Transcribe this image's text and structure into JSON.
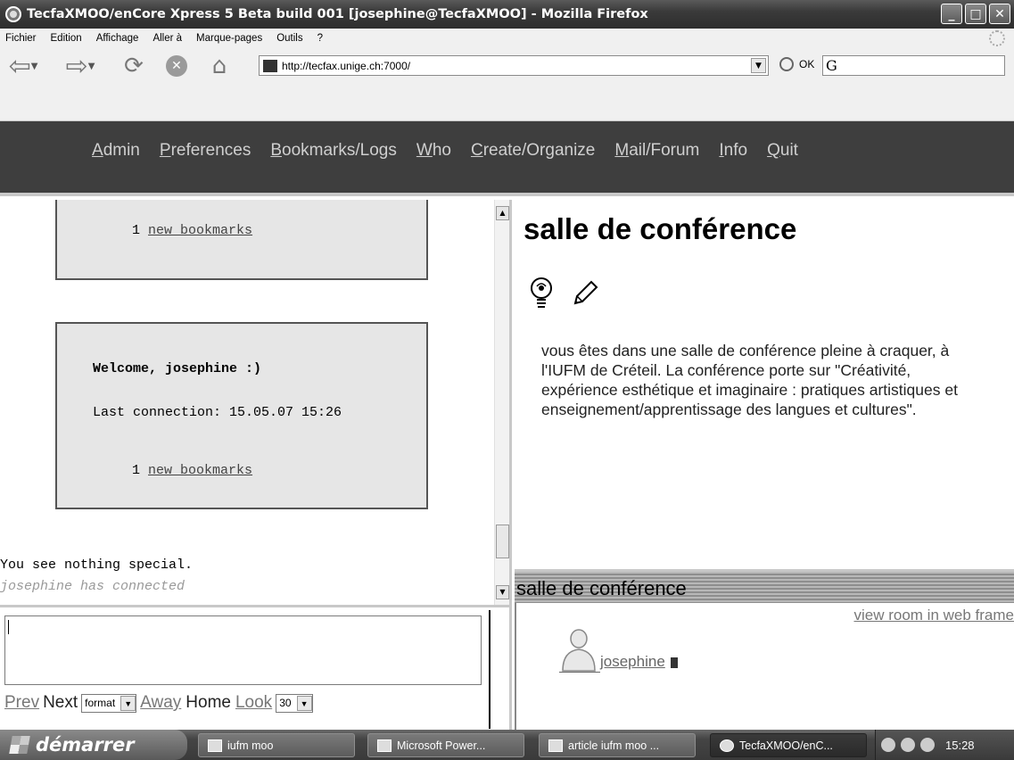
{
  "window": {
    "title": "TecfaXMOO/enCore Xpress 5 Beta build 001 [josephine@TecfaXMOO] - Mozilla Firefox",
    "minimize": "_",
    "maximize": "□",
    "close": "✕"
  },
  "menubar": {
    "items": [
      "Fichier",
      "Edition",
      "Affichage",
      "Aller à",
      "Marque-pages",
      "Outils",
      "?"
    ]
  },
  "navbar": {
    "url": "http://tecfax.unige.ch:7000/",
    "go_label": "OK",
    "search_placeholder": "G"
  },
  "appmenu": {
    "items": [
      {
        "u": "A",
        "rest": "dmin"
      },
      {
        "u": "P",
        "rest": "references"
      },
      {
        "u": "B",
        "rest": "ookmarks/Logs"
      },
      {
        "u": "W",
        "rest": "ho"
      },
      {
        "u": "C",
        "rest": "reate/Organize"
      },
      {
        "u": "M",
        "rest": "ail/Forum"
      },
      {
        "u": "I",
        "rest": "nfo"
      },
      {
        "u": "Q",
        "rest": "uit"
      }
    ]
  },
  "log": {
    "box1": {
      "count": "1",
      "link": "new bookmarks"
    },
    "box2": {
      "welcome": "Welcome, josephine :)",
      "last_connection": "Last connection: 15.05.07 15:26",
      "count": "1",
      "link": "new bookmarks"
    },
    "line1": "You see nothing special.",
    "line2": "josephine has connected"
  },
  "input": {
    "prev": "Prev",
    "next": "Next",
    "format_value": "format",
    "away": "Away",
    "home": "Home",
    "look": "Look",
    "lines_value": "30"
  },
  "room": {
    "title": "salle de conférence",
    "description": "vous êtes dans une salle de conférence pleine à craquer, à l'IUFM de Créteil. La conférence porte sur \"Créativité, expérience esthétique et imaginaire : pratiques artistiques et enseignement/apprentissage des langues et cultures\".",
    "bar_label": "salle de conférence",
    "view_link": "view room in web frame",
    "person": "josephine"
  },
  "taskbar": {
    "start": "démarrer",
    "tasks": [
      "iufm moo",
      "Microsoft Power...",
      "article iufm moo ...",
      "TecfaXMOO/enC..."
    ],
    "clock": "15:28"
  }
}
